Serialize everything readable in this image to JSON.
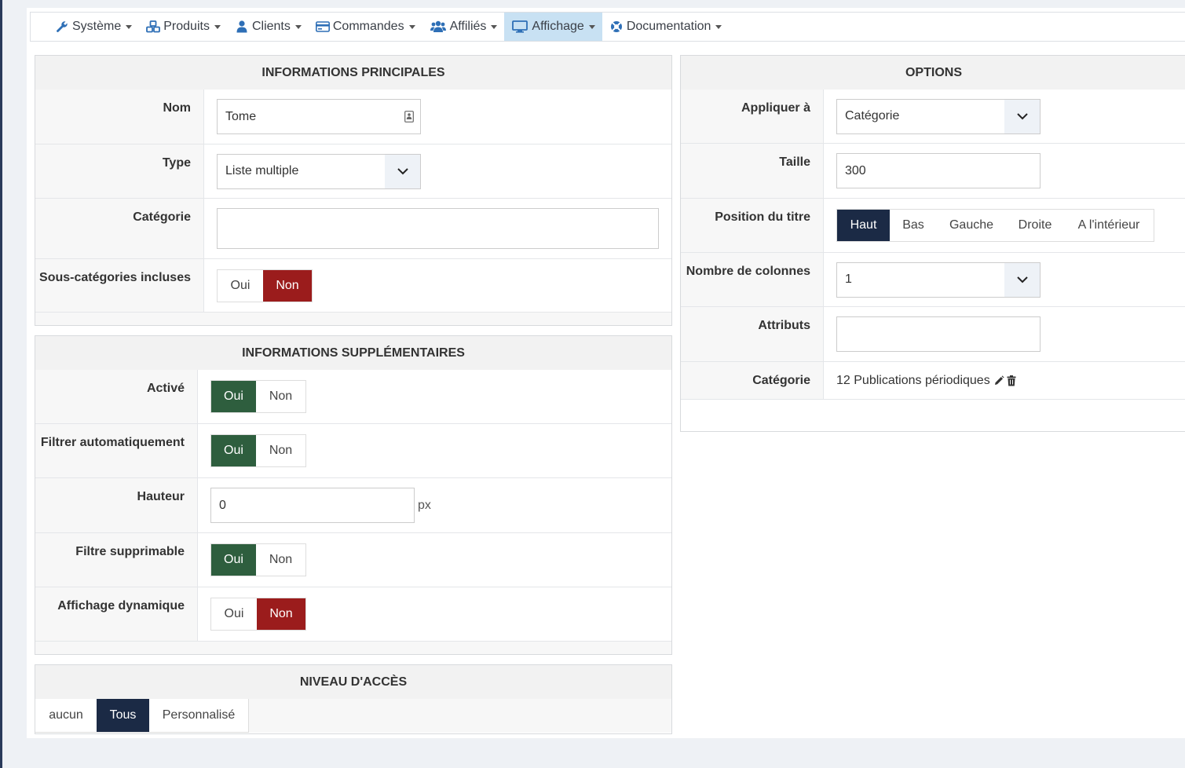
{
  "nav": {
    "items": [
      {
        "label": "Système",
        "icon": "wrench-icon"
      },
      {
        "label": "Produits",
        "icon": "cubes-icon"
      },
      {
        "label": "Clients",
        "icon": "user-icon"
      },
      {
        "label": "Commandes",
        "icon": "credit-card-icon"
      },
      {
        "label": "Affiliés",
        "icon": "users-icon"
      },
      {
        "label": "Affichage",
        "icon": "desktop-icon"
      },
      {
        "label": "Documentation",
        "icon": "lifebuoy-icon"
      }
    ],
    "active": "Affichage"
  },
  "main_info": {
    "title": "INFORMATIONS PRINCIPALES",
    "name_label": "Nom",
    "name_value": "Tome",
    "type_label": "Type",
    "type_value": "Liste multiple",
    "category_label": "Catégorie",
    "category_value": "",
    "subcat_label": "Sous-catégories incluses",
    "subcat_yes": "Oui",
    "subcat_no": "Non",
    "subcat_selected": "Non"
  },
  "extra_info": {
    "title": "INFORMATIONS SUPPLÉMENTAIRES",
    "active_label": "Activé",
    "autofilter_label": "Filtrer automatiquement",
    "height_label": "Hauteur",
    "height_value": "0",
    "height_unit": "px",
    "removable_label": "Filtre supprimable",
    "dynamic_label": "Affichage dynamique",
    "yes": "Oui",
    "no": "Non"
  },
  "access": {
    "title": "NIVEAU D'ACCÈS",
    "options": [
      "aucun",
      "Tous",
      "Personnalisé"
    ],
    "selected": "Tous"
  },
  "options": {
    "title": "OPTIONS",
    "apply_label": "Appliquer à",
    "apply_value": "Catégorie",
    "size_label": "Taille",
    "size_value": "300",
    "title_pos_label": "Position du titre",
    "title_pos_options": [
      "Haut",
      "Bas",
      "Gauche",
      "Droite",
      "A l'intérieur"
    ],
    "title_pos_selected": "Haut",
    "columns_label": "Nombre de colonnes",
    "columns_value": "1",
    "attributes_label": "Attributs",
    "attributes_value": "",
    "category_label": "Catégorie",
    "category_value": "12 Publications périodiques"
  },
  "colors": {
    "green": "#2e5e3e",
    "red": "#9b1c1c",
    "navy": "#1b2a45",
    "active_nav": "#c8e1f3"
  }
}
